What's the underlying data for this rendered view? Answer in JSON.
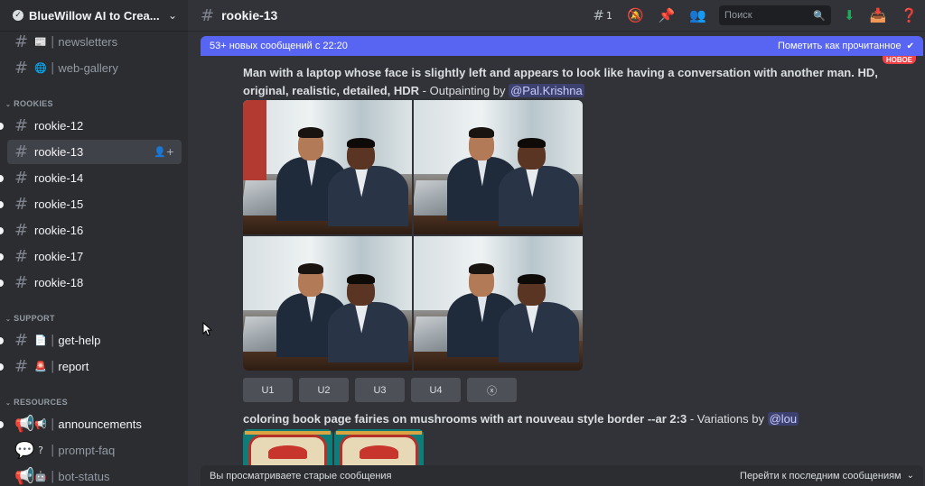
{
  "server": {
    "name": "BlueWillow AI to Crea..."
  },
  "sidebar": {
    "top_channels": [
      {
        "label": "newsletters",
        "emoji": "📰"
      },
      {
        "label": "web-gallery",
        "emoji": "🌐"
      }
    ],
    "categories": {
      "rookies": "ROOKIES",
      "support": "SUPPORT",
      "resources": "RESOURCES"
    },
    "rookies": [
      {
        "label": "rookie-12"
      },
      {
        "label": "rookie-13"
      },
      {
        "label": "rookie-14"
      },
      {
        "label": "rookie-15"
      },
      {
        "label": "rookie-16"
      },
      {
        "label": "rookie-17"
      },
      {
        "label": "rookie-18"
      }
    ],
    "support": [
      {
        "label": "get-help",
        "emoji": "📄"
      },
      {
        "label": "report",
        "emoji": "🚨"
      }
    ],
    "resources": [
      {
        "label": "announcements",
        "emoji": "📢"
      },
      {
        "label": "prompt-faq",
        "emoji": "?"
      },
      {
        "label": "bot-status",
        "emoji": "🤖"
      }
    ]
  },
  "header": {
    "channel": "rookie-13",
    "threads_count": "1",
    "search_placeholder": "Поиск"
  },
  "new_messages_bar": {
    "left": "53+ новых сообщений с 22:20",
    "right": "Пометить как прочитанное"
  },
  "new_badge": "НОВОЕ",
  "messages": [
    {
      "prompt": "Man with a laptop whose face is slightly left and appears to look like having a conversation with another man. HD, original, realistic, detailed, HDR",
      "suffix": " - Outpainting by ",
      "mention": "@Pal.Krishna",
      "buttons": [
        "U1",
        "U2",
        "U3",
        "U4",
        "ⓧ"
      ]
    },
    {
      "prompt": "coloring book page fairies on mushrooms with art nouveau style border --ar 2:3",
      "suffix": " - Variations by ",
      "mention": "@lou"
    }
  ],
  "old_messages_bar": {
    "left": "Вы просматриваете старые сообщения",
    "right": "Перейти к последним сообщениям"
  },
  "colors": {
    "accent": "#5865f2",
    "sidebar_bg": "#2b2d31",
    "chat_bg": "#313338",
    "new_badge": "#f23f43"
  }
}
